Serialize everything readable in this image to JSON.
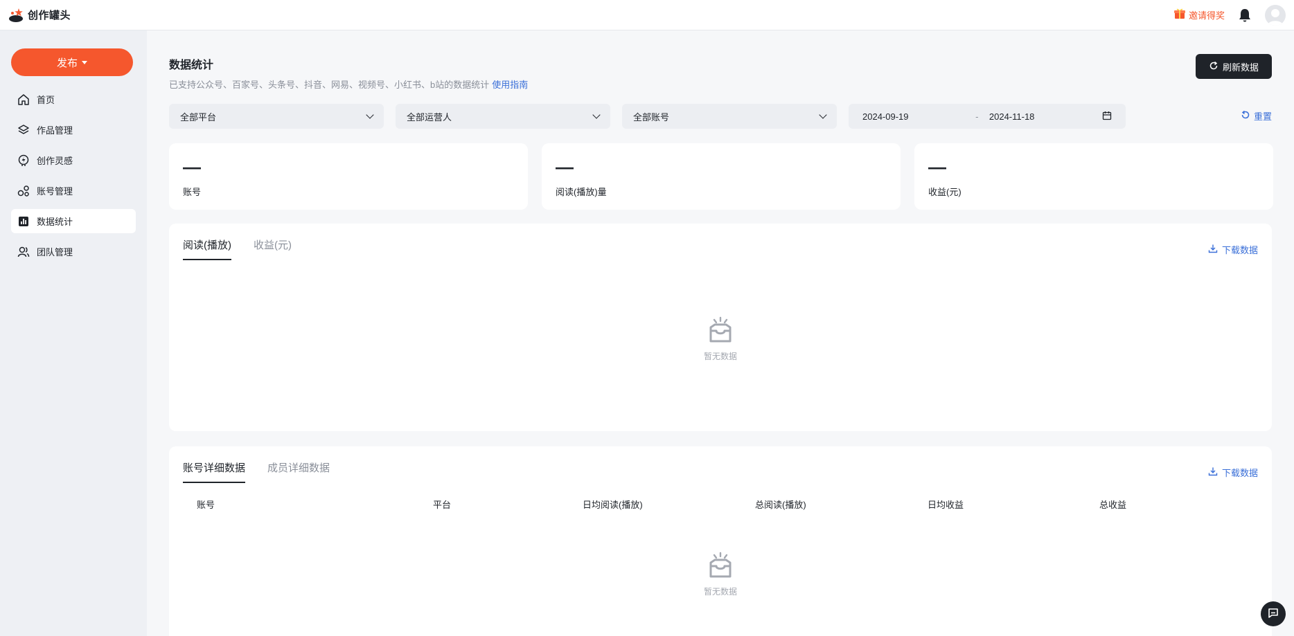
{
  "app": {
    "name": "创作罐头"
  },
  "topbar": {
    "invite_label": "邀请得奖",
    "icons": [
      "gift-icon",
      "bell-icon",
      "avatar-icon"
    ]
  },
  "sidebar": {
    "publish_label": "发布",
    "items": [
      {
        "label": "首页",
        "icon": "home-icon"
      },
      {
        "label": "作品管理",
        "icon": "layers-icon"
      },
      {
        "label": "创作灵感",
        "icon": "lightning-icon"
      },
      {
        "label": "账号管理",
        "icon": "accounts-icon"
      },
      {
        "label": "数据统计",
        "icon": "chart-icon",
        "active": true
      },
      {
        "label": "团队管理",
        "icon": "team-icon"
      }
    ]
  },
  "header": {
    "title": "数据统计",
    "subtitle": "已支持公众号、百家号、头条号、抖音、网易、视频号、小红书、b站的数据统计",
    "guide_link": "使用指南",
    "refresh_label": "刷新数据"
  },
  "filters": {
    "platform": "全部平台",
    "operator": "全部运营人",
    "account": "全部账号",
    "date_start": "2024-09-19",
    "date_sep": "-",
    "date_end": "2024-11-18",
    "reset_label": "重置"
  },
  "stats": [
    {
      "value": "—",
      "label": "账号"
    },
    {
      "value": "—",
      "label": "阅读(播放)量"
    },
    {
      "value": "—",
      "label": "收益(元)"
    }
  ],
  "chart_panel": {
    "tabs": [
      "阅读(播放)",
      "收益(元)"
    ],
    "download_label": "下载数据",
    "empty_text": "暂无数据"
  },
  "detail_panel": {
    "tabs": [
      "账号详细数据",
      "成员详细数据"
    ],
    "download_label": "下载数据",
    "columns": [
      "账号",
      "平台",
      "日均阅读(播放)",
      "总阅读(播放)",
      "日均收益",
      "总收益"
    ],
    "empty_text": "暂无数据"
  },
  "colors": {
    "accent": "#f5572d",
    "link": "#3a6fd8",
    "dark": "#1f2329"
  }
}
